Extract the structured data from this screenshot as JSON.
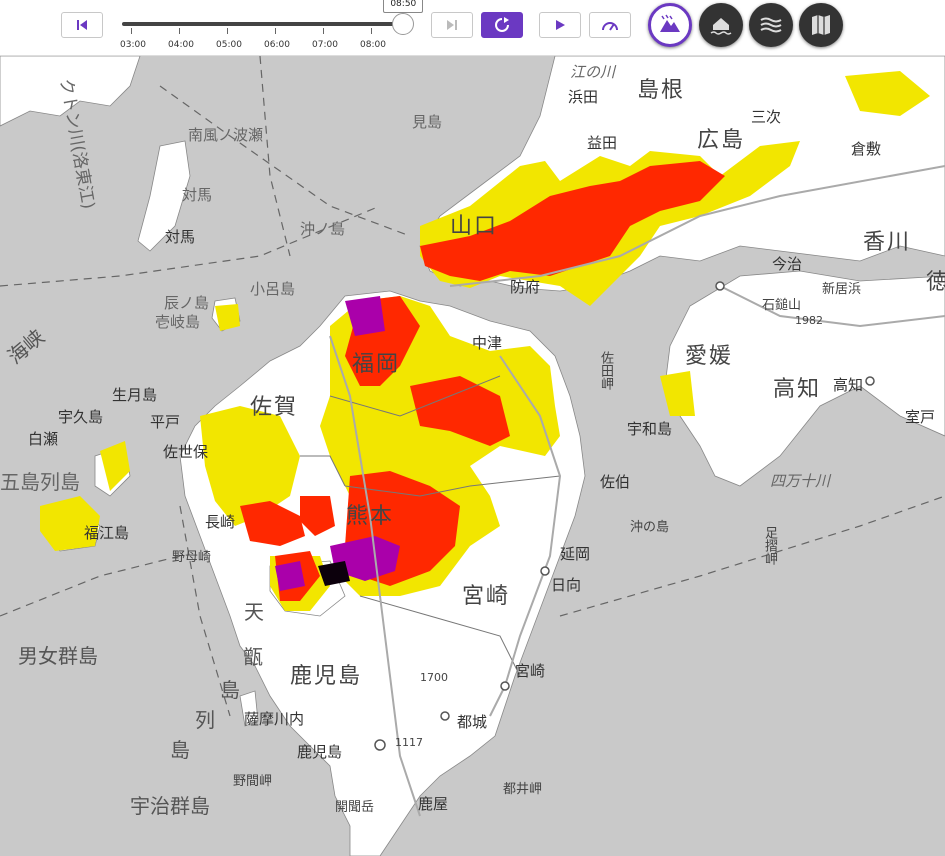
{
  "toolbar": {
    "current_time": "08:50",
    "ticks": [
      "03:00",
      "04:00",
      "05:00",
      "06:00",
      "07:00",
      "08:00"
    ],
    "progress": 0.97
  },
  "map": {
    "colors": {
      "sea": "#c9c9c9",
      "land": "#ffffff",
      "yellow": "#f2e600",
      "red": "#ff2800",
      "purple": "#aa00aa",
      "black": "#0c000c"
    },
    "labels": {
      "shimane": "島根",
      "hiroshima": "広島",
      "yamaguchi": "山口",
      "ehime": "愛媛",
      "kochi": "高知",
      "kagawa": "香川",
      "tokushima": "徳",
      "saga": "佐賀",
      "fukuoka": "福岡",
      "kumamoto": "熊本",
      "miyazaki": "宮崎",
      "kagoshima": "鹿児島",
      "hamada": "浜田",
      "masuda": "益田",
      "miyoshi": "三次",
      "kurashiki": "倉敷",
      "hofu": "防府",
      "nakatsu": "中津",
      "uwajima": "宇和島",
      "saiki": "佐伯",
      "nobeoka": "延岡",
      "hyuga": "日向",
      "miyazaki_city": "宮崎",
      "miyakonojo": "都城",
      "kagoshima_city": "鹿児島",
      "kanoya": "鹿屋",
      "satsumasendai": "薩摩川内",
      "nagasaki": "長崎",
      "sasebo": "佐世保",
      "hirado": "平戸",
      "ikitsuki": "生月島",
      "ukushima": "宇久島",
      "shirase": "白瀬",
      "fukue": "福江島",
      "goto": "五島列島",
      "nomozaki": "野母崎",
      "danjo": "男女群島",
      "koshiki": "甑",
      "koshiki2": "島",
      "koshiki3": "列",
      "koshiki4": "島",
      "uji": "宇治群島",
      "nomamisaki": "野間岬",
      "tsushima": "対馬",
      "tsushima_label": "対馬",
      "iki": "壱岐島",
      "tatsunoshima": "辰ノ島",
      "okinoshima": "沖ノ島",
      "koronoshima": "小呂島",
      "mishima": "見島",
      "nampu": "南風ノ波瀬",
      "nakdong": "クトン川(洛東江)",
      "kaikyo": "海峡",
      "gonokawa": "江の川",
      "sadamisaki": "佐田岬",
      "okinoshima2": "沖の島",
      "ashizuri": "足摺岬",
      "shimanto": "四万十川",
      "ishizuchi": "石鎚山",
      "ishizuchi_h": "1982",
      "imabari": "今治",
      "niihama": "新居浜",
      "muroto": "室戸",
      "toimisaki": "都井岬",
      "kaimon": "開聞岳",
      "h1700": "1700",
      "h1117": "1117",
      "amakusa": "天",
      "nishi_tottori": "倉敷",
      "kochi_city": "高知"
    }
  }
}
